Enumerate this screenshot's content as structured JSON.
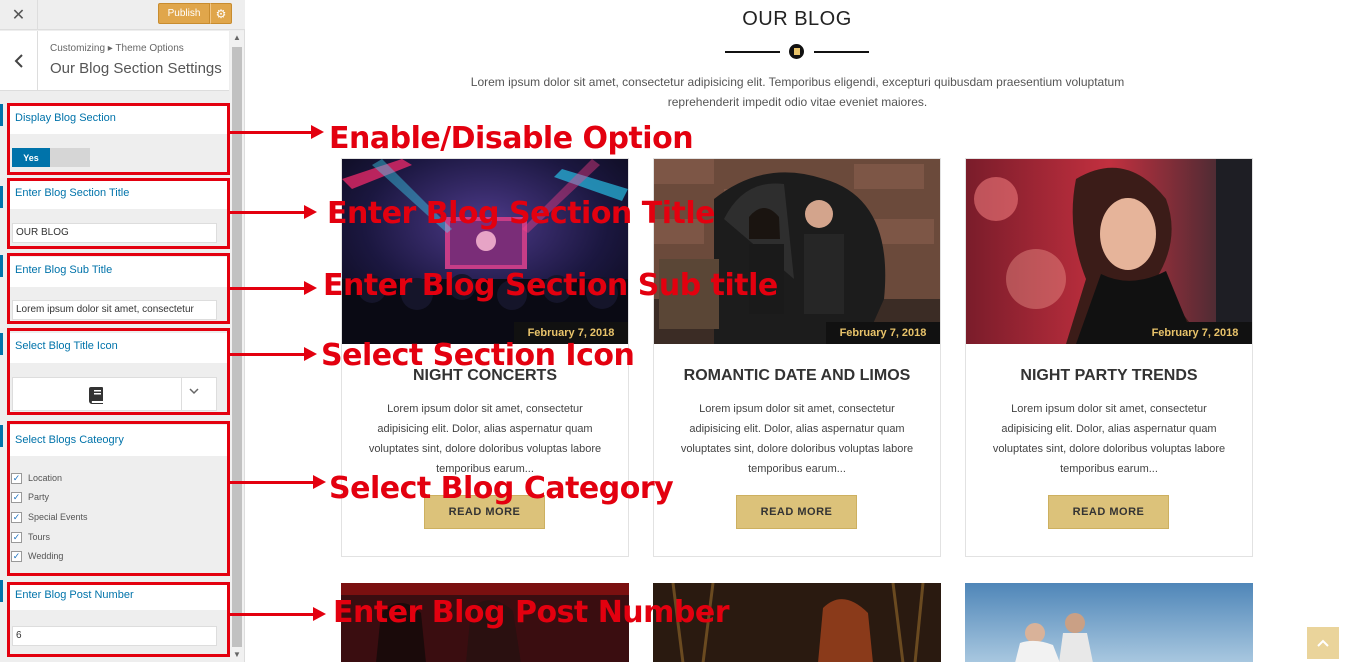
{
  "customizer": {
    "close_icon": "close-icon",
    "publish_label": "Publish",
    "gear_icon": "gear-icon",
    "breadcrumb": "Customizing ▸ Theme Options",
    "section_title": "Our Blog Section Settings",
    "controls": {
      "display_label": "Display Blog Section",
      "toggle_value": "Yes",
      "title_label": "Enter Blog Section Title",
      "title_value": "OUR BLOG",
      "subtitle_label": "Enter Blog Sub Title",
      "subtitle_value": "Lorem ipsum dolor sit amet, consectetur",
      "icon_label": "Select Blog Title Icon",
      "icon_value": "book-icon",
      "category_label": "Select Blogs Cateogry",
      "categories": [
        {
          "label": "Location",
          "checked": true
        },
        {
          "label": "Party",
          "checked": true
        },
        {
          "label": "Special Events",
          "checked": true
        },
        {
          "label": "Tours",
          "checked": true
        },
        {
          "label": "Wedding",
          "checked": true
        }
      ],
      "post_number_label": "Enter Blog Post Number",
      "post_number_value": "6"
    }
  },
  "annotations": [
    "Enable/Disable Option",
    "Enter Blog Section Title",
    "Enter Blog Section Sub title",
    "Select Section Icon",
    "Select Blog Category",
    "Enter Blog Post Number"
  ],
  "preview": {
    "title": "OUR BLOG",
    "subtitle": "Lorem ipsum dolor sit amet, consectetur adipisicing elit. Temporibus eligendi, excepturi quibusdam praesentium voluptatum reprehenderit impedit odio vitae eveniet maiores.",
    "posts": [
      {
        "title": "NIGHT CONCERTS",
        "date": "February 7, 2018",
        "text": "Lorem ipsum dolor sit amet, consectetur adipisicing elit. Dolor, alias aspernatur quam voluptates sint, dolore doloribus voluptas labore temporibus earum...",
        "button": "READ MORE"
      },
      {
        "title": "ROMANTIC DATE AND LIMOS",
        "date": "February 7, 2018",
        "text": "Lorem ipsum dolor sit amet, consectetur adipisicing elit. Dolor, alias aspernatur quam voluptates sint, dolore doloribus voluptas labore temporibus earum...",
        "button": "READ MORE"
      },
      {
        "title": "NIGHT PARTY TRENDS",
        "date": "February 7, 2018",
        "text": "Lorem ipsum dolor sit amet, consectetur adipisicing elit. Dolor, alias aspernatur quam voluptates sint, dolore doloribus voluptas labore temporibus earum...",
        "button": "READ MORE"
      }
    ],
    "scroll_top_icon": "chevron-up-icon"
  },
  "colors": {
    "accent_red": "#e3000f",
    "wp_blue": "#0073aa",
    "publish_orange": "#e0a64b",
    "gold": "#dcc27a"
  }
}
